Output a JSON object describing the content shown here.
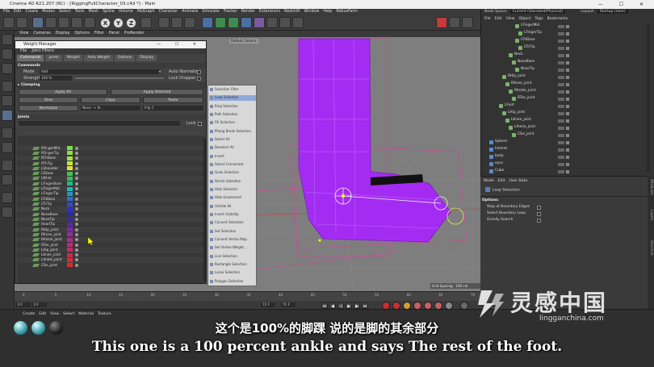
{
  "window": {
    "title": "Cinema 4D R21.207 (RC) - [RiggingFullCharacter_03.c4d *] - Main",
    "layout_label": "Layout:",
    "layout_value": "Startup (User)",
    "mode_space_label": "Node Space:",
    "mode_space_value": "Current (Standard/Physical)"
  },
  "menubar": [
    "File",
    "Edit",
    "Create",
    "Modes",
    "Select",
    "Tools",
    "Mesh",
    "Spline",
    "Volume",
    "MoGraph",
    "Character",
    "Animate",
    "Simulate",
    "Tracker",
    "Render",
    "Extensions",
    "Redshift",
    "Window",
    "Help",
    "RebusFarm"
  ],
  "viewport": {
    "menu": [
      "View",
      "Cameras",
      "Display",
      "Options",
      "Filter",
      "Panel",
      "ProRender"
    ],
    "camera_tag": "Default Camera",
    "grid_spacing": "Grid Spacing : 100 cm"
  },
  "weight_manager": {
    "title": "Weight Manager",
    "menu": [
      "File",
      "Joint Filters"
    ],
    "tabs": [
      "Commands",
      "Joints",
      "Weight",
      "Auto Weight",
      "Options",
      "Display"
    ],
    "commands_header": "Commands",
    "mode_label": "Mode",
    "mode_value": "Add",
    "strength_label": "Strength",
    "strength_value": "100 %",
    "auto_normalize": "Auto Normalize",
    "lock_dropper": "Lock Dropper",
    "clamping": "Clamping",
    "apply_all": "Apply All",
    "apply_selected": "Apply Selected",
    "zero": "Zero",
    "copy": "Copy",
    "paste": "Paste",
    "normalize": "Normalize",
    "mirror_value": "None -> N...",
    "flip_value": "Flip C",
    "joints_header": "Joints",
    "lock_label": "Lock",
    "joints": [
      "RFingerMid",
      "RFingerTip",
      "RThBase",
      "RThTip",
      "LShoulder",
      "LElbow",
      "LWrist",
      "LFingerBase",
      "LFingerMid",
      "LFingerTip",
      "LThBase",
      "LThTip",
      "Neck",
      "NoseBase",
      "NoseTip",
      "HeadTip",
      "RHip_joint",
      "RKnee_joint",
      "RAnkle_joint",
      "RToe_joint",
      "LHip_joint",
      "LKnee_joint",
      "LAnkle_joint",
      "LToe_joint"
    ],
    "joint_colors": [
      "#7fdc4a",
      "#8fe040",
      "#a8e040",
      "#c6e23e",
      "#e2e23e",
      "#3ec84a",
      "#2fbf5c",
      "#24b98a",
      "#22b6b0",
      "#2496c8",
      "#2a70d0",
      "#3248d0",
      "#3030c8",
      "#2828b0",
      "#3a2aa8",
      "#5a2aa8",
      "#7c2aa8",
      "#9a2aa0",
      "#b02a90",
      "#c02a7a",
      "#c82a60",
      "#d02a48",
      "#d82a36",
      "#e02a2a"
    ]
  },
  "context_menu": {
    "items": [
      "Selection Filter",
      "Loop Selection",
      "Ring Selection",
      "Path Selection",
      "Fill Selection",
      "Phong Break Selection",
      "Select All",
      "Deselect All",
      "Invert",
      "Select Connected",
      "Grow Selection",
      "Shrink Selection",
      "Hide Selected",
      "Hide Unselected",
      "Unhide All",
      "Invert Visibility",
      "Convert Selection",
      "Set Selection",
      "Convert Vertex Map...",
      "Set Vertex Weight...",
      "Live Selection",
      "Rectangle Selection",
      "Lasso Selection",
      "Polygon Selection"
    ],
    "highlighted": "Loop Selection"
  },
  "object_manager": {
    "menu": [
      "File",
      "Edit",
      "View",
      "Object",
      "Tags",
      "Bookmarks"
    ],
    "items": [
      "LFingerMid",
      "LFingerTip",
      "LThBase",
      "LThTip",
      "Neck",
      "NoseBase",
      "NoseTip",
      "RHip_joint",
      "RKnee_joint",
      "RAnkle_joint",
      "RToe_joint",
      "LFoot",
      "LHip_joint",
      "LKnee_joint",
      "LAnkle_joint",
      "LToe_joint",
      "Sphere",
      "helmet",
      "body",
      "eyes",
      "Cube"
    ]
  },
  "attributes": {
    "menu": [
      "Mode",
      "Edit",
      "User Data"
    ],
    "title": "Loop Selection",
    "options_header": "Options",
    "options": [
      "Stop at Boundary Edges",
      "Select Boundary Loop",
      "Greedy Search"
    ]
  },
  "timeline": {
    "start_frame": "0 F",
    "current_frame": "0 F",
    "end_frame": "72 F",
    "max_frame": "72 F",
    "tick_labels": [
      "0",
      "5",
      "10",
      "15",
      "20",
      "25",
      "30",
      "35",
      "40",
      "45",
      "50",
      "55",
      "60",
      "65",
      "70"
    ]
  },
  "material_manager": {
    "menu": [
      "Create",
      "Edit",
      "View",
      "Select",
      "Material",
      "Texture"
    ]
  },
  "subtitles": {
    "cn": "这个是100%的脚踝 说的是脚的其余部分",
    "en": "This one is a 100 percent ankle and says The rest of the foot."
  },
  "watermark": {
    "cn": "灵感中国",
    "en": "lingganchina.com"
  },
  "side_tabs": [
    "Attributes",
    "Layers",
    "Structure"
  ],
  "colors": {
    "mesh": "#a82df0",
    "mesh_edges": "#c070ff",
    "viewport_bg": "#7f7f7f"
  }
}
